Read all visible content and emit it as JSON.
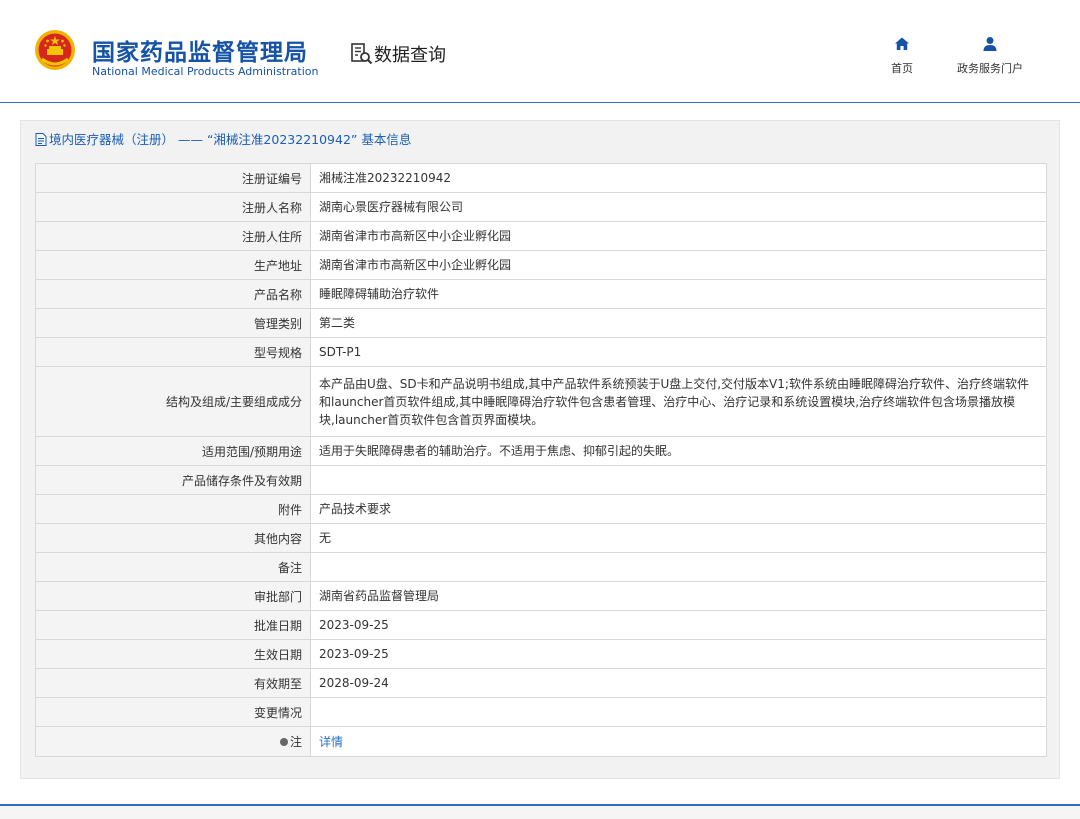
{
  "header": {
    "org_name_cn": "国家药品监督管理局",
    "org_name_en": "National Medical Products Administration",
    "emblem_icon": "national-emblem-icon",
    "section_label": "数据查询",
    "nav": [
      {
        "label": "首页",
        "icon": "home-icon"
      },
      {
        "label": "政务服务门户",
        "icon": "user-icon"
      }
    ]
  },
  "panel": {
    "title": "境内医疗器械（注册） —— “湘械注准20232210942” 基本信息"
  },
  "rows": [
    {
      "label": "注册证编号",
      "value": "湘械注准20232210942"
    },
    {
      "label": "注册人名称",
      "value": "湖南心景医疗器械有限公司"
    },
    {
      "label": "注册人住所",
      "value": "湖南省津市市高新区中小企业孵化园"
    },
    {
      "label": "生产地址",
      "value": "湖南省津市市高新区中小企业孵化园"
    },
    {
      "label": "产品名称",
      "value": "睡眠障碍辅助治疗软件"
    },
    {
      "label": "管理类别",
      "value": "第二类"
    },
    {
      "label": "型号规格",
      "value": "SDT-P1"
    },
    {
      "label": "结构及组成/主要组成成分",
      "value": "本产品由U盘、SD卡和产品说明书组成,其中产品软件系统预装于U盘上交付,交付版本V1;软件系统由睡眠障碍治疗软件、治疗终端软件和launcher首页软件组成,其中睡眠障碍治疗软件包含患者管理、治疗中心、治疗记录和系统设置模块,治疗终端软件包含场景播放模块,launcher首页软件包含首页界面模块。"
    },
    {
      "label": "适用范围/预期用途",
      "value": "适用于失眠障碍患者的辅助治疗。不适用于焦虑、抑郁引起的失眠。"
    },
    {
      "label": "产品储存条件及有效期",
      "value": ""
    },
    {
      "label": "附件",
      "value": "产品技术要求"
    },
    {
      "label": "其他内容",
      "value": "无"
    },
    {
      "label": "备注",
      "value": ""
    },
    {
      "label": "审批部门",
      "value": "湖南省药品监督管理局"
    },
    {
      "label": "批准日期",
      "value": "2023-09-25"
    },
    {
      "label": "生效日期",
      "value": "2023-09-25"
    },
    {
      "label": "有效期至",
      "value": "2028-09-24"
    },
    {
      "label": "变更情况",
      "value": ""
    },
    {
      "label": "注",
      "value": "详情"
    }
  ],
  "colors": {
    "brand_blue": "#1553a6",
    "link_blue": "#2a72c9",
    "emblem_red": "#d7261e",
    "emblem_gold": "#f5c400"
  }
}
